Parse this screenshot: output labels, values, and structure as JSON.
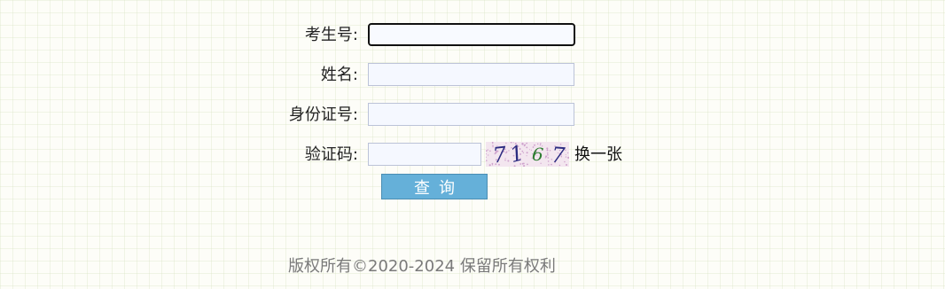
{
  "form": {
    "exam_id": {
      "label": "考生号:",
      "value": "",
      "placeholder": ""
    },
    "name": {
      "label": "姓名:",
      "value": "",
      "placeholder": ""
    },
    "id_card": {
      "label": "身份证号:",
      "value": "",
      "placeholder": ""
    },
    "captcha": {
      "label": "验证码:",
      "value": "",
      "placeholder": "",
      "image_text": "7167",
      "refresh_label": "换一张"
    },
    "submit_label": "查询"
  },
  "footer": {
    "copyright": "版权所有©2020-2024 保留所有权利"
  }
}
